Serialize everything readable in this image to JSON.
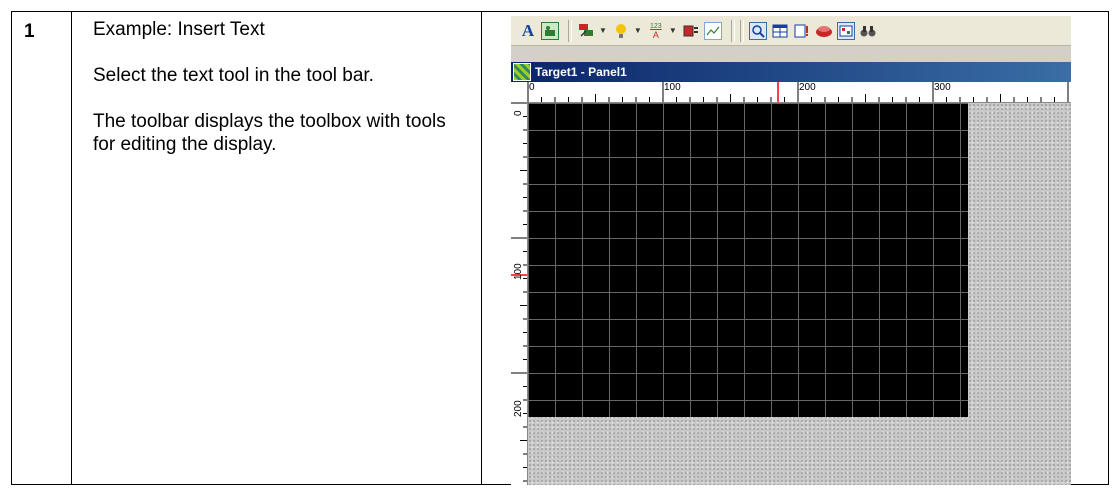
{
  "step": {
    "number": "1"
  },
  "instructions": {
    "heading": "Example:  Insert Text",
    "line1": "Select the text tool in the tool bar.",
    "line2": "The toolbar displays the toolbox with tools for editing the display."
  },
  "screenshot": {
    "window_title": "Target1 - Panel1",
    "toolbar_icons": [
      "text-tool-icon",
      "image-icon",
      "fill-color-icon",
      "lightbulb-icon",
      "number-format-icon",
      "button-icon",
      "trend-icon",
      "zoom-icon",
      "table-icon",
      "alarm-icon",
      "red-object-icon",
      "panel-icon",
      "binoculars-icon"
    ],
    "toolbar_text_glyph": "A",
    "number_format_glyph": "123",
    "ruler_h": {
      "label_0": "0",
      "label_100": "100",
      "label_200": "200",
      "label_300": "300"
    },
    "ruler_v": {
      "label_0": "0",
      "label_100": "100",
      "label_200": "200"
    },
    "colors": {
      "panel_bg": "#000000",
      "title_bar": "#0a246a",
      "ruler_marker": "#ff0000"
    }
  }
}
